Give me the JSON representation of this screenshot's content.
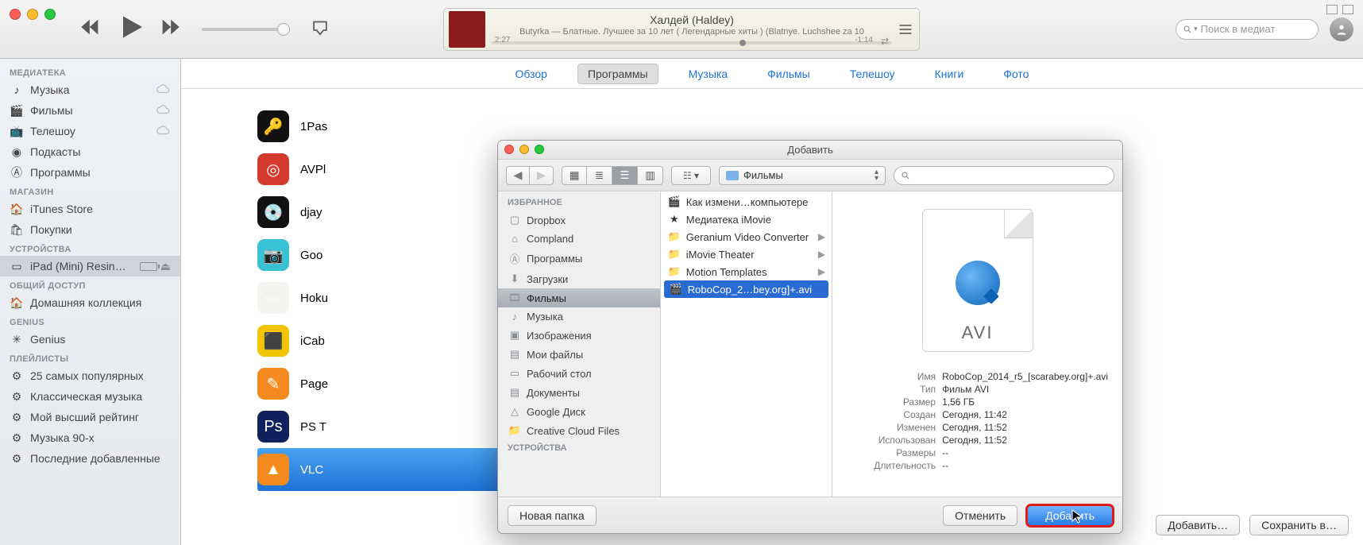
{
  "nowPlaying": {
    "title": "Халдей (Haldey)",
    "subtitle": "Butyrka — Блатные. Лучшее за 10 лет ( Легендарные хиты ) (Blatnye. Luchshee za 10",
    "elapsed": "2:27",
    "remaining": "-1:14"
  },
  "search": {
    "placeholder": "Поиск в медиат"
  },
  "sidebar": {
    "sections": [
      {
        "title": "МЕДИАТЕКА",
        "items": [
          {
            "label": "Музыка",
            "cloud": true
          },
          {
            "label": "Фильмы",
            "cloud": true
          },
          {
            "label": "Телешоу",
            "cloud": true
          },
          {
            "label": "Подкасты"
          },
          {
            "label": "Программы"
          }
        ]
      },
      {
        "title": "МАГАЗИН",
        "items": [
          {
            "label": "iTunes Store"
          },
          {
            "label": "Покупки"
          }
        ]
      },
      {
        "title": "УСТРОЙСТВА",
        "items": [
          {
            "label": "iPad (Mini) Resin…",
            "device": true
          }
        ]
      },
      {
        "title": "ОБЩИЙ ДОСТУП",
        "items": [
          {
            "label": "Домашняя коллекция"
          }
        ]
      },
      {
        "title": "GENIUS",
        "items": [
          {
            "label": "Genius"
          }
        ]
      },
      {
        "title": "ПЛЕЙЛИСТЫ",
        "items": [
          {
            "label": "25 самых популярных"
          },
          {
            "label": "Классическая музыка"
          },
          {
            "label": "Мой высший рейтинг"
          },
          {
            "label": "Музыка 90-х"
          },
          {
            "label": "Последние добавленные"
          }
        ]
      }
    ]
  },
  "tabs": {
    "items": [
      "Обзор",
      "Программы",
      "Музыка",
      "Фильмы",
      "Телешоу",
      "Книги",
      "Фото"
    ],
    "active": 1
  },
  "apps": [
    {
      "name": "1Pas",
      "icon": "🔑",
      "bg": "#111"
    },
    {
      "name": "AVPl",
      "icon": "◎",
      "bg": "#d43b2e"
    },
    {
      "name": "djay",
      "icon": "💿",
      "bg": "#111"
    },
    {
      "name": "Goo",
      "icon": "📷",
      "bg": "#39c1d4"
    },
    {
      "name": "Hoku",
      "icon": "〰",
      "bg": "#f4f4f0"
    },
    {
      "name": "iCab",
      "icon": "⬛",
      "bg": "#f3c500"
    },
    {
      "name": "Page",
      "icon": "✎",
      "bg": "#f58b1f"
    },
    {
      "name": "PS T",
      "icon": "Ps",
      "bg": "#10215e"
    },
    {
      "name": "VLC",
      "icon": "▲",
      "bg": "#f58b1f",
      "selected": true
    }
  ],
  "footer": {
    "add": "Добавить…",
    "save": "Сохранить в…"
  },
  "dialog": {
    "title": "Добавить",
    "location": "Фильмы",
    "sidebar": {
      "favTitle": "ИЗБРАННОЕ",
      "items": [
        {
          "label": "Dropbox",
          "icon": "box"
        },
        {
          "label": "Compland",
          "icon": "house"
        },
        {
          "label": "Программы",
          "icon": "A"
        },
        {
          "label": "Загрузки",
          "icon": "down"
        },
        {
          "label": "Фильмы",
          "icon": "film",
          "selected": true
        },
        {
          "label": "Музыка",
          "icon": "note"
        },
        {
          "label": "Изображения",
          "icon": "pic"
        },
        {
          "label": "Мои файлы",
          "icon": "doc"
        },
        {
          "label": "Рабочий стол",
          "icon": "desk"
        },
        {
          "label": "Документы",
          "icon": "doc"
        },
        {
          "label": "Google Диск",
          "icon": "drive"
        },
        {
          "label": "Creative Cloud Files",
          "icon": "folder"
        }
      ],
      "devTitle": "УСТРОЙСТВА"
    },
    "files": [
      {
        "label": "Как измени…компьютере",
        "type": "mov"
      },
      {
        "label": "Медиатека iMovie",
        "type": "star"
      },
      {
        "label": "Geranium Video Converter",
        "type": "folder",
        "hasChildren": true
      },
      {
        "label": "iMovie Theater",
        "type": "folder",
        "hasChildren": true
      },
      {
        "label": "Motion Templates",
        "type": "folder",
        "hasChildren": true
      },
      {
        "label": "RoboCop_2…bey.org]+.avi",
        "type": "mov",
        "selected": true
      }
    ],
    "preview": {
      "ext": "AVI",
      "rows": [
        {
          "k": "Имя",
          "v": "RoboCop_2014_r5_[scarabey.org]+.avi"
        },
        {
          "k": "Тип",
          "v": "Фильм AVI"
        },
        {
          "k": "Размер",
          "v": "1,56 ГБ"
        },
        {
          "k": "Создан",
          "v": "Сегодня, 11:42"
        },
        {
          "k": "Изменен",
          "v": "Сегодня, 11:52"
        },
        {
          "k": "Использован",
          "v": "Сегодня, 11:52"
        },
        {
          "k": "Размеры",
          "v": "--"
        },
        {
          "k": "Длительность",
          "v": "--"
        }
      ]
    },
    "buttons": {
      "newFolder": "Новая папка",
      "cancel": "Отменить",
      "add": "Добавить"
    }
  }
}
